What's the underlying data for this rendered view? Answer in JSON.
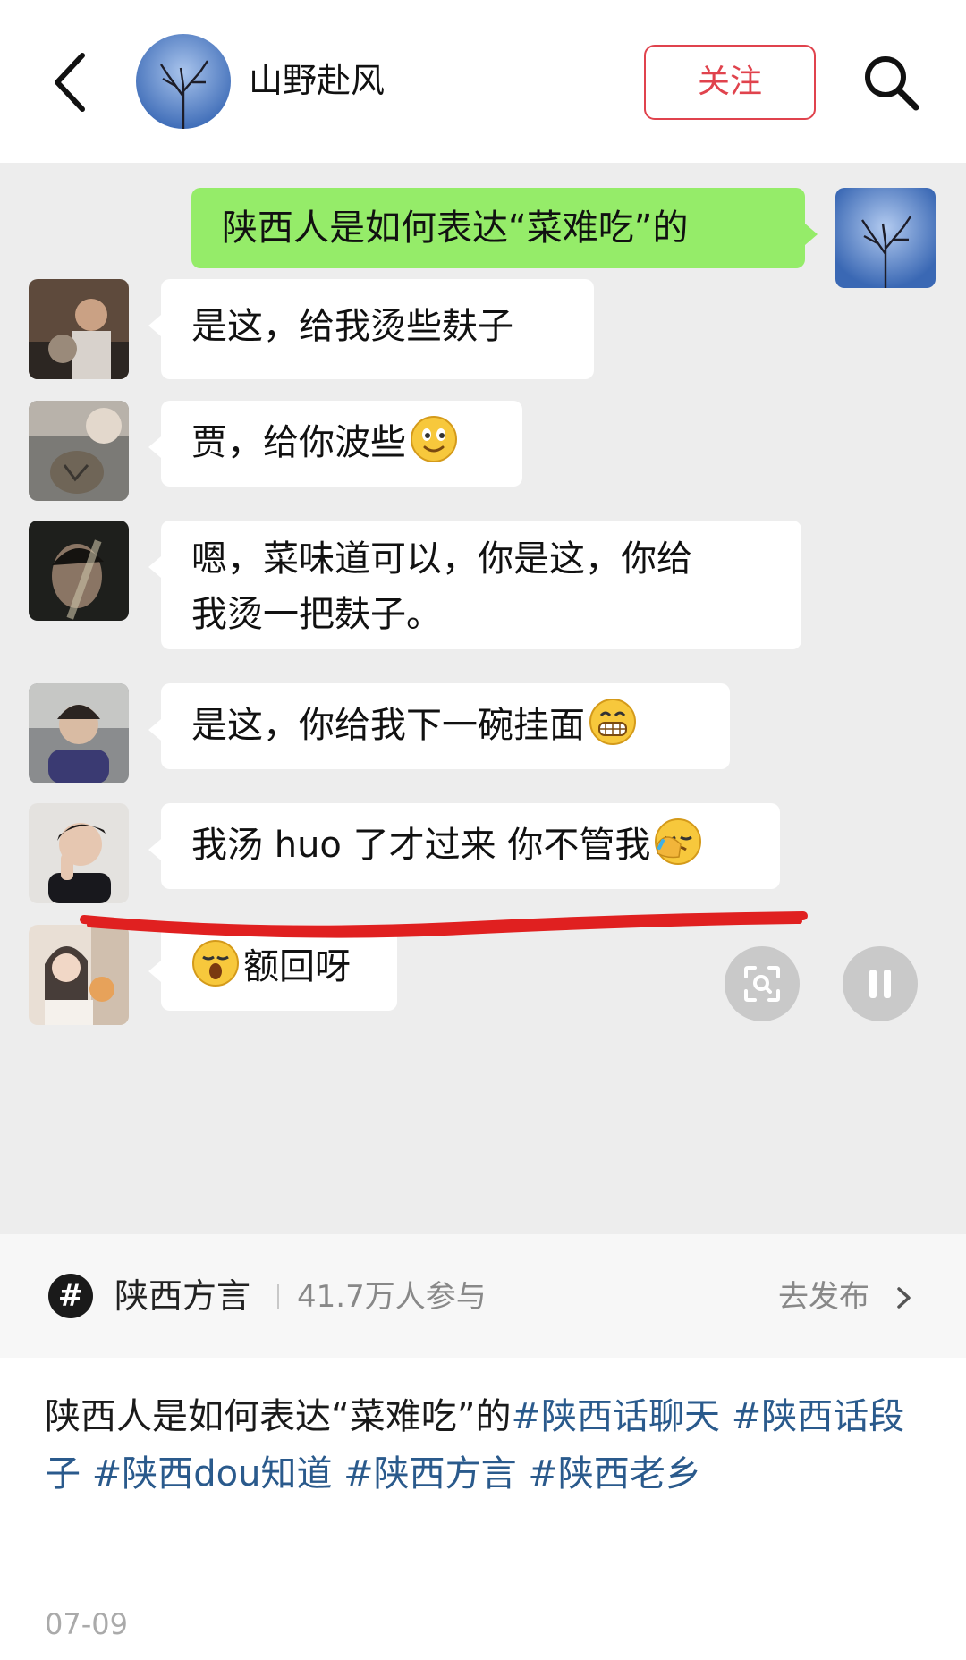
{
  "header": {
    "back_icon": "chevron-left-icon",
    "user_name": "山野赴风",
    "follow_label": "关注",
    "search_icon": "search-icon"
  },
  "chat": {
    "question": "陕西人是如何表达“菜难吃”的",
    "replies": [
      {
        "text": "是这，给我烫些麸子",
        "emoji": null
      },
      {
        "text": "贾，给你波些",
        "emoji": "smile-emoji"
      },
      {
        "line1": "嗯，菜味道可以，你是这，你给",
        "line2": "我烫一把麸子。",
        "emoji": null
      },
      {
        "text": "是这，你给我下一碗挂面",
        "emoji": "grin-emoji"
      },
      {
        "text": "我汤 huo 了才过来 你不管我",
        "emoji": "facepalm-emoji"
      },
      {
        "text": "额回呀",
        "emoji": "yawn-emoji"
      }
    ],
    "underline_color": "#e02020"
  },
  "controls": {
    "scan_icon": "scan-icon",
    "pause_icon": "pause-icon"
  },
  "topic": {
    "icon": "#",
    "name": "陕西方言",
    "count": "41.7万人参与",
    "post_label": "去发布",
    "chevron_icon": "chevron-right-icon"
  },
  "caption": {
    "text": "陕西人是如何表达“菜难吃”的",
    "tags": [
      "#陕西话聊天",
      "#陕西话段子",
      "#陕西dou知道",
      "#陕西方言",
      "#陕西老乡"
    ]
  },
  "date": "07-09",
  "colors": {
    "accent_red": "#e0434d",
    "bubble_green": "#95ec69",
    "tag_blue": "#2a5a8c"
  }
}
